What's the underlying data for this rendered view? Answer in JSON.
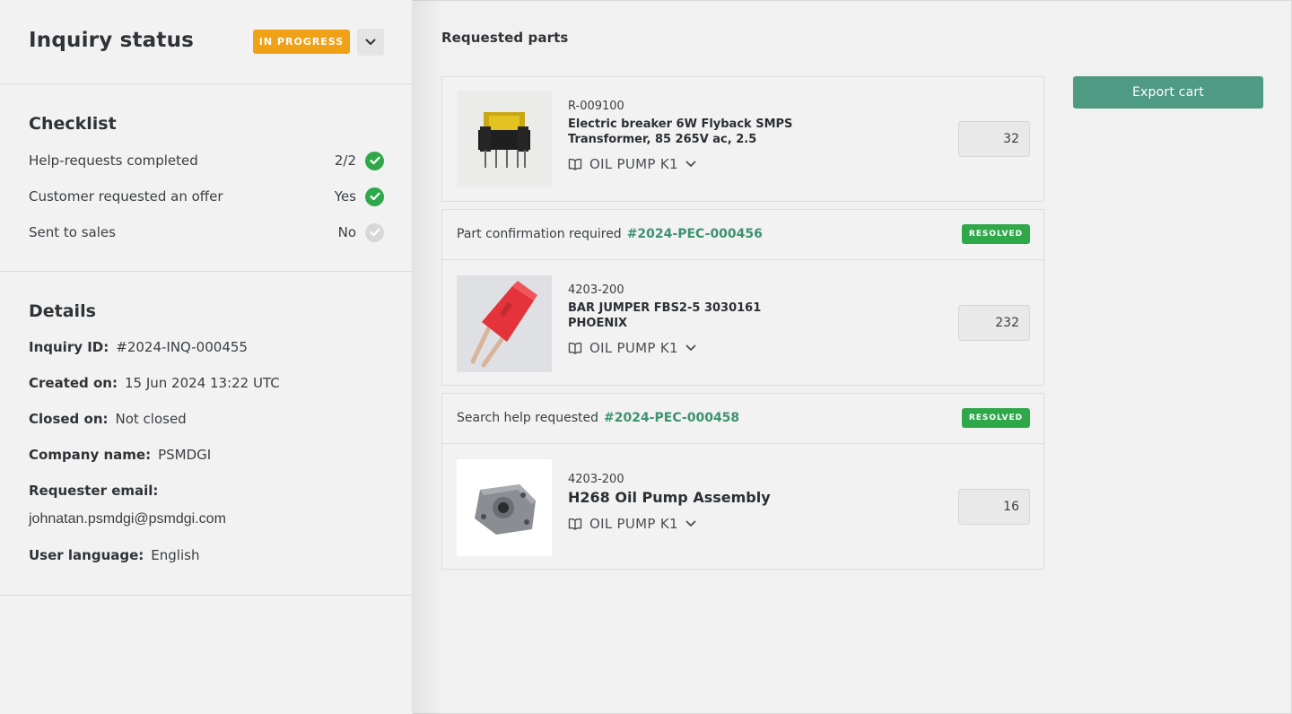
{
  "status": {
    "title": "Inquiry status",
    "badge": "IN PROGRESS",
    "badge_color": "#f0a115",
    "dropdown_icon": "chevron-down-icon"
  },
  "checklist": {
    "title": "Checklist",
    "items": [
      {
        "label": "Help-requests completed",
        "value": "2/2",
        "state": "done"
      },
      {
        "label": "Customer requested an offer",
        "value": "Yes",
        "state": "done"
      },
      {
        "label": "Sent to sales",
        "value": "No",
        "state": "pending"
      }
    ]
  },
  "details": {
    "title": "Details",
    "inquiry_id_label": "Inquiry ID:",
    "inquiry_id": "#2024-INQ-000455",
    "created_label": "Created on:",
    "created": "15 Jun 2024 13:22 UTC",
    "closed_label": "Closed on:",
    "closed": "Not closed",
    "company_label": "Company name:",
    "company": "PSMDGI",
    "email_label": "Requester email:",
    "email": "johnatan.psmdgi@psmdgi.com",
    "language_label": "User language:",
    "language": "English"
  },
  "requested": {
    "title": "Requested parts",
    "export_label": "Export cart",
    "export_color": "#4f9a83",
    "parts": [
      {
        "part_no": "R-009100",
        "name": "Electric breaker 6W Flyback SMPS Transformer, 85 265V ac, 2.5",
        "machine": "OIL PUMP K1",
        "qty": "32"
      },
      {
        "header_label": "Part confirmation required",
        "header_ref": "#2024-PEC-000456",
        "badge": "RESOLVED",
        "part_no": "4203-200",
        "name": "BAR JUMPER FBS2-5 3030161 PHOENIX",
        "machine": "OIL PUMP K1",
        "qty": "232"
      },
      {
        "header_label": "Search help requested",
        "header_ref": "#2024-PEC-000458",
        "badge": "RESOLVED",
        "part_no": "4203-200",
        "name": "H268 Oil Pump Assembly",
        "machine": "OIL PUMP K1",
        "qty": "16"
      }
    ]
  }
}
